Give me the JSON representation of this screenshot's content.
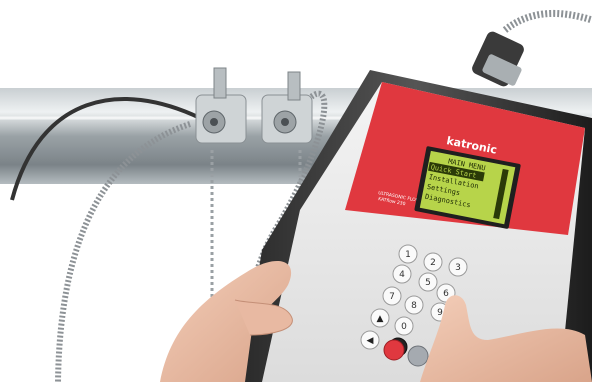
{
  "device": {
    "brand": "katronic",
    "model_line1": "ULTRASONIC FLOWMETER",
    "model_line2": "KATflow 230",
    "screen": {
      "title": "MAIN MENU",
      "items": [
        "Quick Start",
        "Installation",
        "Settings",
        "Diagnostics"
      ],
      "selected_index": 0
    },
    "keypad": [
      "1",
      "2",
      "3",
      "4",
      "5",
      "6",
      "7",
      "8",
      "9",
      "0"
    ]
  },
  "colors": {
    "housing_red": "#e0383f",
    "lcd_green": "#b7d44a",
    "pipe": "#9aa2a6",
    "background": "#ffffff"
  }
}
